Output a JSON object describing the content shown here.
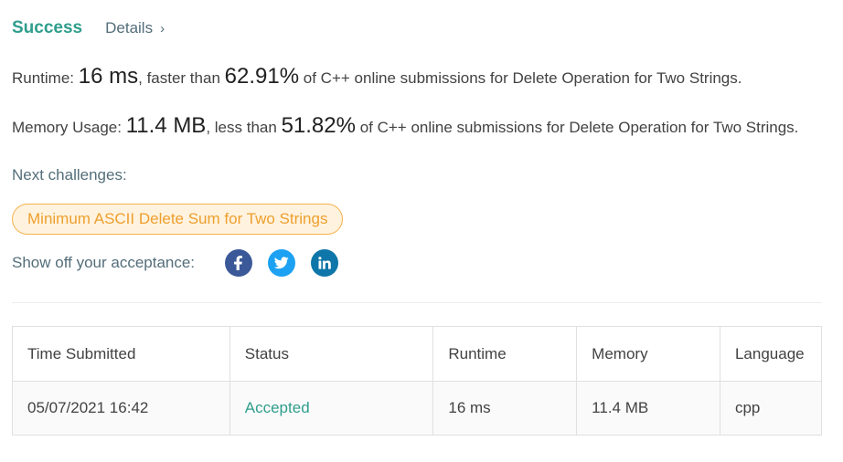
{
  "header": {
    "status": "Success",
    "details_label": "Details",
    "details_chevron": "›"
  },
  "runtime": {
    "label": "Runtime:",
    "value": "16 ms",
    "comparison": ", faster than",
    "percent": "62.91%",
    "suffix": "of C++ online submissions for Delete Operation for Two Strings."
  },
  "memory": {
    "label": "Memory Usage:",
    "value": "11.4 MB",
    "comparison": ", less than",
    "percent": "51.82%",
    "suffix": "of C++ online submissions for Delete Operation for Two Strings."
  },
  "next": {
    "label": "Next challenges:",
    "challenges": [
      "Minimum ASCII Delete Sum for Two Strings"
    ]
  },
  "share": {
    "label": "Show off your acceptance:",
    "icons": [
      {
        "name": "facebook-icon",
        "color": "#3b5998"
      },
      {
        "name": "twitter-icon",
        "color": "#1da1f2"
      },
      {
        "name": "linkedin-icon",
        "color": "#0e76a8"
      }
    ]
  },
  "table": {
    "columns": [
      "Time Submitted",
      "Status",
      "Runtime",
      "Memory",
      "Language"
    ],
    "rows": [
      [
        "05/07/2021 16:42",
        "Accepted",
        "16 ms",
        "11.4 MB",
        "cpp"
      ]
    ]
  },
  "colors": {
    "accent": "#2f9e8c",
    "challenge_text": "#ee9f2e",
    "challenge_bg": "#fff3df"
  }
}
